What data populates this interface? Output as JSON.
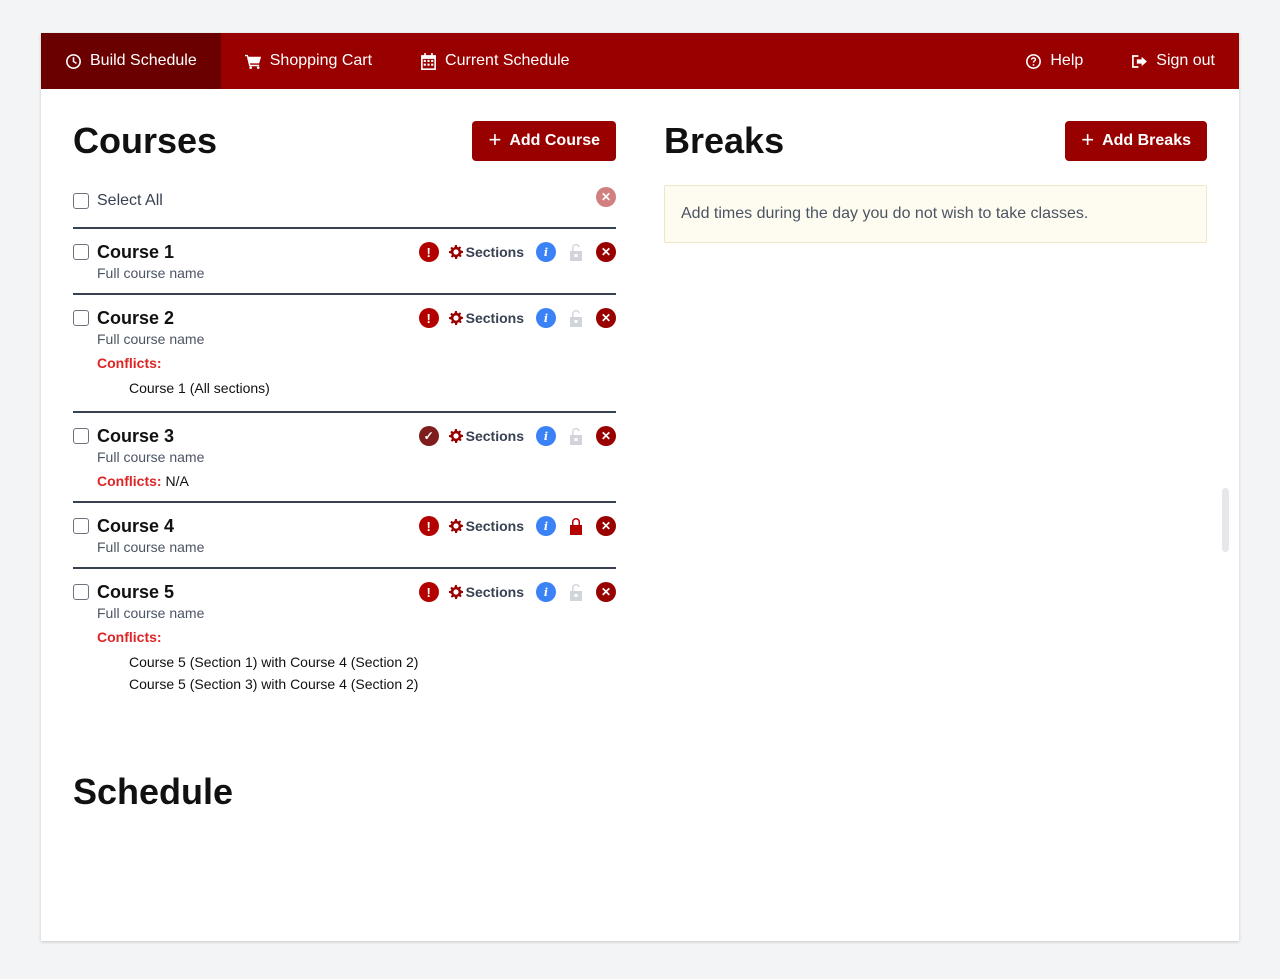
{
  "nav": {
    "build_schedule": "Build Schedule",
    "shopping_cart": "Shopping Cart",
    "current_schedule": "Current Schedule",
    "help": "Help",
    "sign_out": "Sign out"
  },
  "courses_section": {
    "title": "Courses",
    "add_button": "Add Course",
    "select_all": "Select All"
  },
  "courses": [
    {
      "title": "Course 1",
      "full_name": "Full course name",
      "status": "alert",
      "sections_label": "Sections",
      "locked": false
    },
    {
      "title": "Course 2",
      "full_name": "Full course name",
      "status": "alert",
      "sections_label": "Sections",
      "locked": false,
      "conflicts_label": "Conflicts:",
      "conflicts": [
        "Course 1 (All sections)"
      ]
    },
    {
      "title": "Course 3",
      "full_name": "Full course name",
      "status": "ok",
      "sections_label": "Sections",
      "locked": false,
      "conflicts_label": "Conflicts:",
      "conflicts_value": "N/A"
    },
    {
      "title": "Course 4",
      "full_name": "Full course name",
      "status": "alert",
      "sections_label": "Sections",
      "locked": true
    },
    {
      "title": "Course 5",
      "full_name": "Full course name",
      "status": "alert",
      "sections_label": "Sections",
      "locked": false,
      "conflicts_label": "Conflicts:",
      "conflicts": [
        "Course 5 (Section 1) with Course 4 (Section 2)",
        "Course 5 (Section 3) with Course 4 (Section 2)"
      ]
    }
  ],
  "breaks_section": {
    "title": "Breaks",
    "add_button": "Add Breaks",
    "note": "Add times during the day you do not wish to take classes."
  },
  "schedule_section": {
    "title": "Schedule"
  },
  "colors": {
    "brand": "#990000",
    "brand_dark": "#6b0000",
    "conflict": "#dc2626",
    "info": "#3b82f6"
  }
}
